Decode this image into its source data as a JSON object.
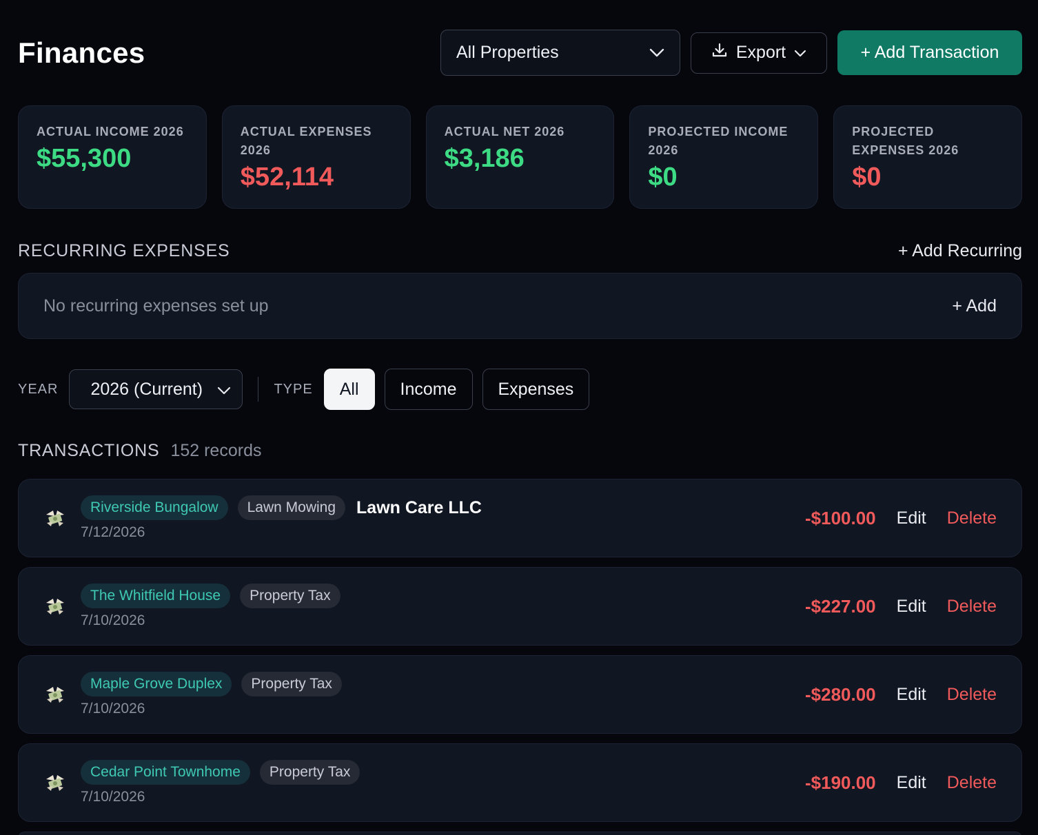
{
  "header": {
    "title": "Finances",
    "property_select": "All Properties",
    "export_label": "Export",
    "add_transaction_label": "+ Add Transaction"
  },
  "stats": [
    {
      "label": "ACTUAL INCOME 2026",
      "value": "$55,300",
      "color": "#3ddc84"
    },
    {
      "label": "ACTUAL EXPENSES 2026",
      "value": "$52,114",
      "color": "#f05a5a"
    },
    {
      "label": "ACTUAL NET 2026",
      "value": "$3,186",
      "color": "#3ddc84"
    },
    {
      "label": "PROJECTED INCOME 2026",
      "value": "$0",
      "color": "#3ddc84"
    },
    {
      "label": "PROJECTED EXPENSES 2026",
      "value": "$0",
      "color": "#f05a5a"
    }
  ],
  "recurring": {
    "title": "RECURRING EXPENSES",
    "add_recurring_label": "+ Add Recurring",
    "empty_text": "No recurring expenses set up",
    "add_label": "+ Add"
  },
  "filters": {
    "year_label": "YEAR",
    "year_value": "2026 (Current)",
    "type_label": "TYPE",
    "types": [
      "All",
      "Income",
      "Expenses"
    ],
    "active_type": "All"
  },
  "transactions": {
    "title": "TRANSACTIONS",
    "count": "152 records",
    "edit_label": "Edit",
    "delete_label": "Delete",
    "items": [
      {
        "property": "Riverside Bungalow",
        "category": "Lawn Mowing",
        "vendor": "Lawn Care LLC",
        "date": "7/12/2026",
        "amount": "-$100.00"
      },
      {
        "property": "The Whitfield House",
        "category": "Property Tax",
        "vendor": "",
        "date": "7/10/2026",
        "amount": "-$227.00"
      },
      {
        "property": "Maple Grove Duplex",
        "category": "Property Tax",
        "vendor": "",
        "date": "7/10/2026",
        "amount": "-$280.00"
      },
      {
        "property": "Cedar Point Townhome",
        "category": "Property Tax",
        "vendor": "",
        "date": "7/10/2026",
        "amount": "-$190.00"
      }
    ]
  },
  "colors": {
    "accent": "#117a65",
    "income": "#3ddc84",
    "expense": "#f05a5a",
    "property_tag": "#3fc9b4"
  },
  "icons": {
    "transaction": "money-wings-icon",
    "export": "download-icon",
    "dropdown": "chevron-down-icon"
  }
}
